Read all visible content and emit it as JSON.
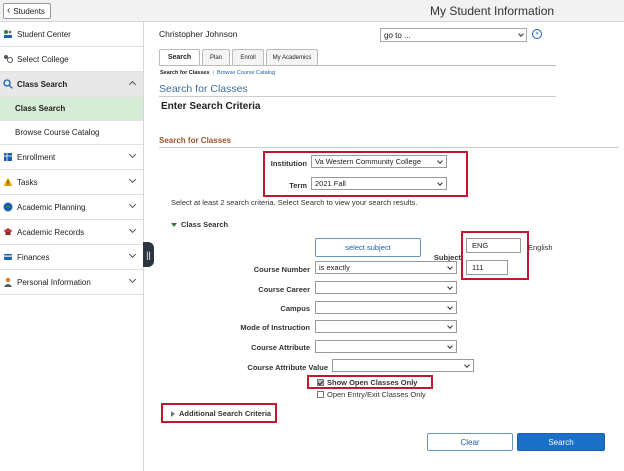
{
  "header": {
    "back_label": "Students",
    "title": "My Student Information"
  },
  "sidebar": {
    "items": [
      {
        "label": "Student Center",
        "icon": "student-center-icon"
      },
      {
        "label": "Select College",
        "icon": "select-college-icon"
      },
      {
        "label": "Class Search",
        "icon": "search-icon",
        "expanded": true
      },
      {
        "label": "Class Search",
        "sub": true,
        "active": true
      },
      {
        "label": "Browse Course Catalog",
        "sub": true
      },
      {
        "label": "Enrollment",
        "icon": "enrollment-icon"
      },
      {
        "label": "Tasks",
        "icon": "warning-icon"
      },
      {
        "label": "Academic Planning",
        "icon": "academic-planning-icon"
      },
      {
        "label": "Academic Records",
        "icon": "academic-records-icon"
      },
      {
        "label": "Finances",
        "icon": "finances-icon"
      },
      {
        "label": "Personal Information",
        "icon": "personal-info-icon"
      }
    ]
  },
  "main": {
    "user_name": "Christopher Johnson",
    "goto": {
      "value": "go to ..."
    },
    "tabs": [
      {
        "label": "Search",
        "active": true
      },
      {
        "label": "Plan"
      },
      {
        "label": "Enroll"
      },
      {
        "label": "My Academics"
      }
    ],
    "subtabs": {
      "current": "Search for Classes",
      "separator": "|",
      "link": "Browse Course Catalog"
    },
    "page_heading": "Search for Classes",
    "enter_criteria": "Enter Search Criteria",
    "section_title": "Search for Classes",
    "institution": {
      "label": "Institution",
      "value": "Va Western Community College"
    },
    "term": {
      "label": "Term",
      "value": "2021 Fall"
    },
    "instructions": "Select at least 2 search criteria. Select Search to view your search results.",
    "class_search_header": "Class Search",
    "select_subject_label": "select subject",
    "subject": {
      "label": "Subject",
      "value": "ENG",
      "description": "English"
    },
    "course_number": {
      "label": "Course Number",
      "operator": "is exactly",
      "value": "111"
    },
    "course_career": {
      "label": "Course Career",
      "value": ""
    },
    "campus": {
      "label": "Campus",
      "value": ""
    },
    "mode_of_instruction": {
      "label": "Mode of Instruction",
      "value": ""
    },
    "course_attribute": {
      "label": "Course Attribute",
      "value": ""
    },
    "course_attribute_value": {
      "label": "Course Attribute Value",
      "value": ""
    },
    "show_open_only": {
      "label": "Show Open Classes Only",
      "checked": true
    },
    "open_entry_exit": {
      "label": "Open Entry/Exit Classes Only",
      "checked": false
    },
    "additional_criteria": "Additional Search Criteria",
    "clear_label": "Clear",
    "search_label": "Search"
  },
  "colors": {
    "highlight_red": "#c0192d",
    "primary_blue": "#1a6fc7",
    "active_green": "#d6ecd6",
    "section_brown": "#a0522d"
  }
}
